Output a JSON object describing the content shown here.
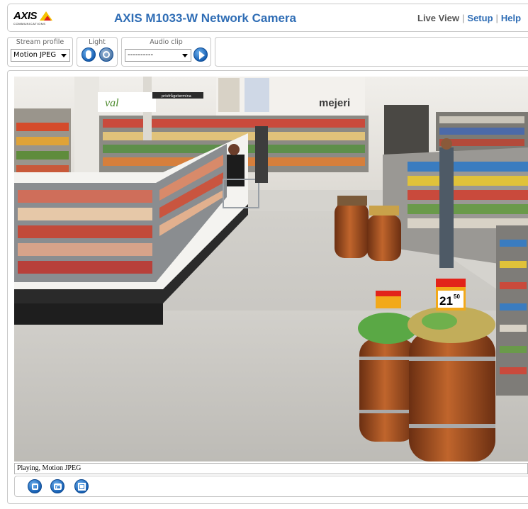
{
  "header": {
    "logo_text": "AXIS",
    "logo_subtext": "COMMUNICATIONS",
    "title": "AXIS M1033-W Network Camera",
    "nav": {
      "live_view": "Live View",
      "separator": "|",
      "setup": "Setup",
      "help": "Help"
    }
  },
  "controls": {
    "stream_profile": {
      "label": "Stream profile",
      "value": "Motion JPEG"
    },
    "light": {
      "label": "Light"
    },
    "audio_clip": {
      "label": "Audio clip",
      "value": "----------"
    }
  },
  "video": {
    "sign_left": "val",
    "sign_dark": "prisfrågetermina",
    "sign_right": "mejeri",
    "price_tag_left": "Erbjudande",
    "price_tag_right": "21",
    "price_tag_right_cents": "50",
    "price_tag_right_top": "Erbjudande"
  },
  "status": {
    "text": "Playing, Motion JPEG"
  },
  "colors": {
    "accent": "#2f6db5",
    "icon_blue": "#1760b4",
    "logo_yellow": "#f5c400",
    "logo_red": "#e2231a"
  },
  "icons": [
    "axis-logo",
    "light-on-icon",
    "light-off-icon",
    "play-icon",
    "stop-icon",
    "snapshot-icon",
    "fullscreen-icon"
  ]
}
